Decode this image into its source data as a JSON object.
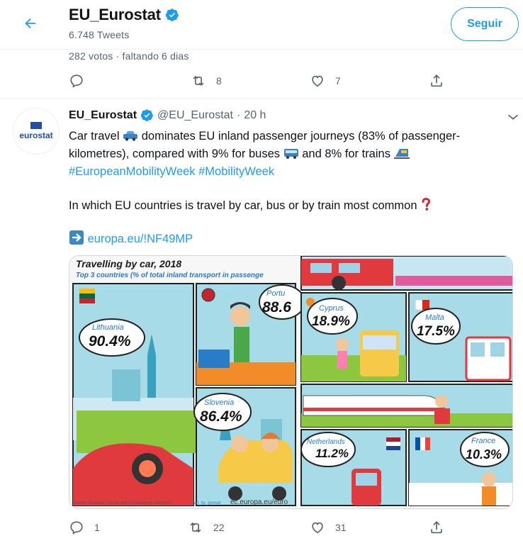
{
  "header": {
    "title": "EU_Eurostat",
    "tweet_count": "6.748 Tweets",
    "follow_label": "Seguir"
  },
  "prev_tweet": {
    "poll_meta": "282 votos · faltando 6 dias",
    "replies": "",
    "retweets": "8",
    "likes": "7"
  },
  "tweet": {
    "avatar_text": "eurostat",
    "name": "EU_Eurostat",
    "handle": "@EU_Eurostat",
    "sep": "·",
    "time": "20 h",
    "line1_a": "Car travel",
    "line1_b": "dominates EU inland passenger journeys (83% of passenger-",
    "line2_a": "kilometres), compared with 9% for buses",
    "line2_b": "and 8% for trains",
    "hashtags": "#EuropeanMobilityWeek #MobilityWeek",
    "question": "In which EU countries is travel by car, bus or by train most common",
    "link": "europa.eu/!NF49MP",
    "replies": "1",
    "retweets": "22",
    "likes": "31"
  },
  "infographic": {
    "title": "Travelling by car, 2018",
    "subtitle": "Top 3 countries (% of total inland transport in passenge",
    "panels": [
      {
        "country": "Lithuania",
        "value": "90.4%"
      },
      {
        "country": "Portu",
        "value": "88.6"
      },
      {
        "country": "Slovenia",
        "value": "86.4%"
      },
      {
        "country": "Cyprus",
        "value": "18.9%"
      },
      {
        "country": "Malta",
        "value": "17.5%"
      },
      {
        "country": "Netherlands",
        "value": "11.2%"
      },
      {
        "country": "France",
        "value": "10.3%"
      }
    ],
    "source": "Source: Eurostat, Modal split of passenger transport",
    "source_code": "tran_hv_psmod",
    "source_site": "ec.europa.eu/euro"
  },
  "colors": {
    "accent": "#1d9bf0",
    "text_secondary": "#536471",
    "border": "#eff3f4",
    "eurostat_blue": "#1f4fa0"
  }
}
